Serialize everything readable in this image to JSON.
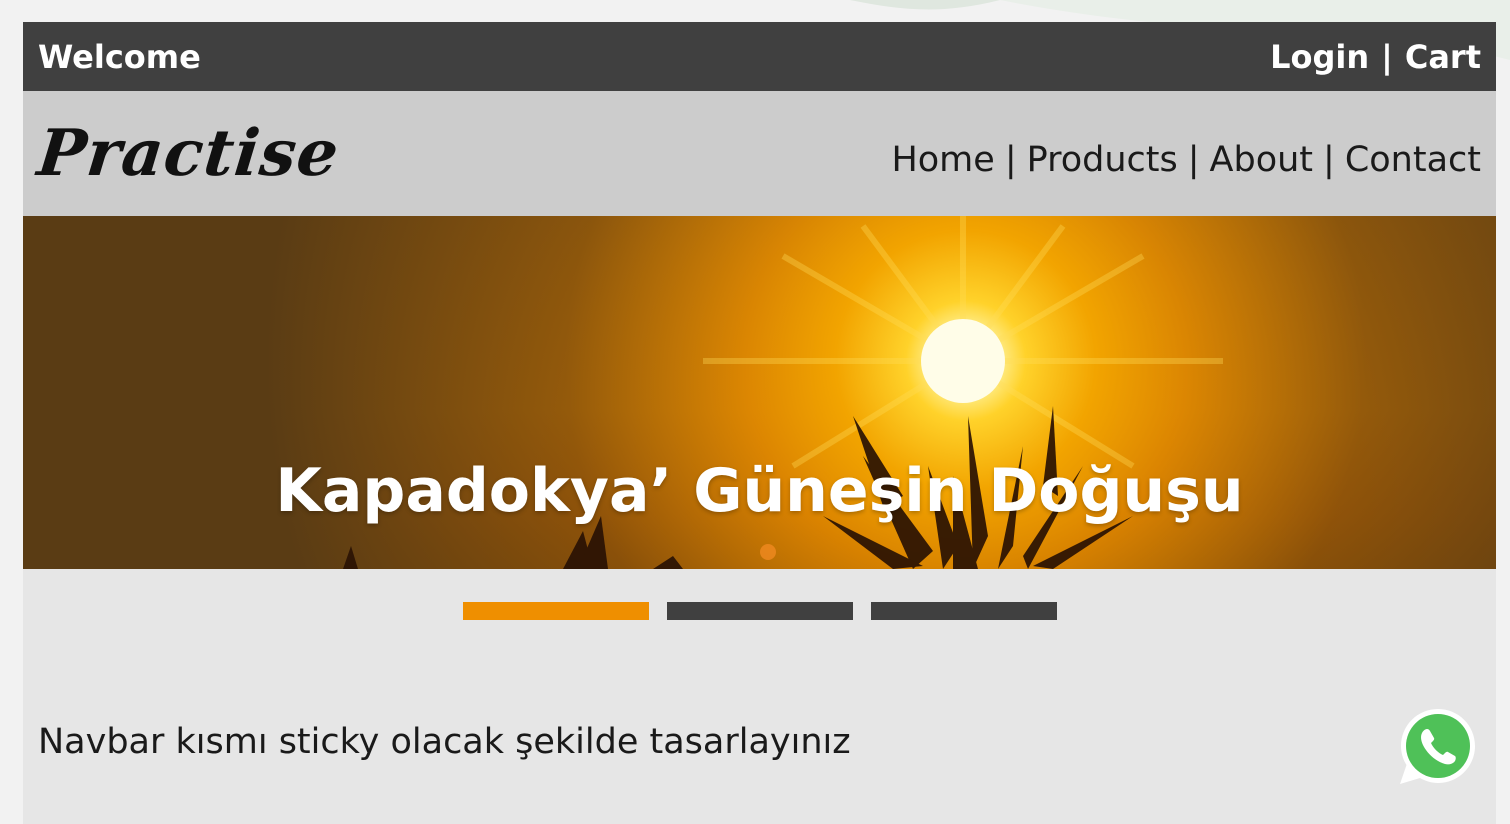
{
  "topbar": {
    "welcome": "Welcome",
    "login": "Login",
    "separator": "|",
    "cart": "Cart"
  },
  "navbar": {
    "logo": "Practise",
    "links": [
      "Home",
      "Products",
      "About",
      "Contact"
    ],
    "separator": "|"
  },
  "hero": {
    "title": "Kapadokya’ Güneşin Doğuşu",
    "slides_total": 3,
    "active_slide": 1
  },
  "content": {
    "text": "Navbar kısmı sticky olacak şekilde tasarlayınız"
  },
  "icons": {
    "whatsapp": "whatsapp-icon"
  },
  "colors": {
    "topbar_bg": "#404040",
    "navbar_bg": "#cccccc",
    "page_bg": "#e6e6e6",
    "accent_active": "#ef8f00",
    "indicator_inactive": "#404040",
    "whatsapp_green": "#4fc158"
  }
}
